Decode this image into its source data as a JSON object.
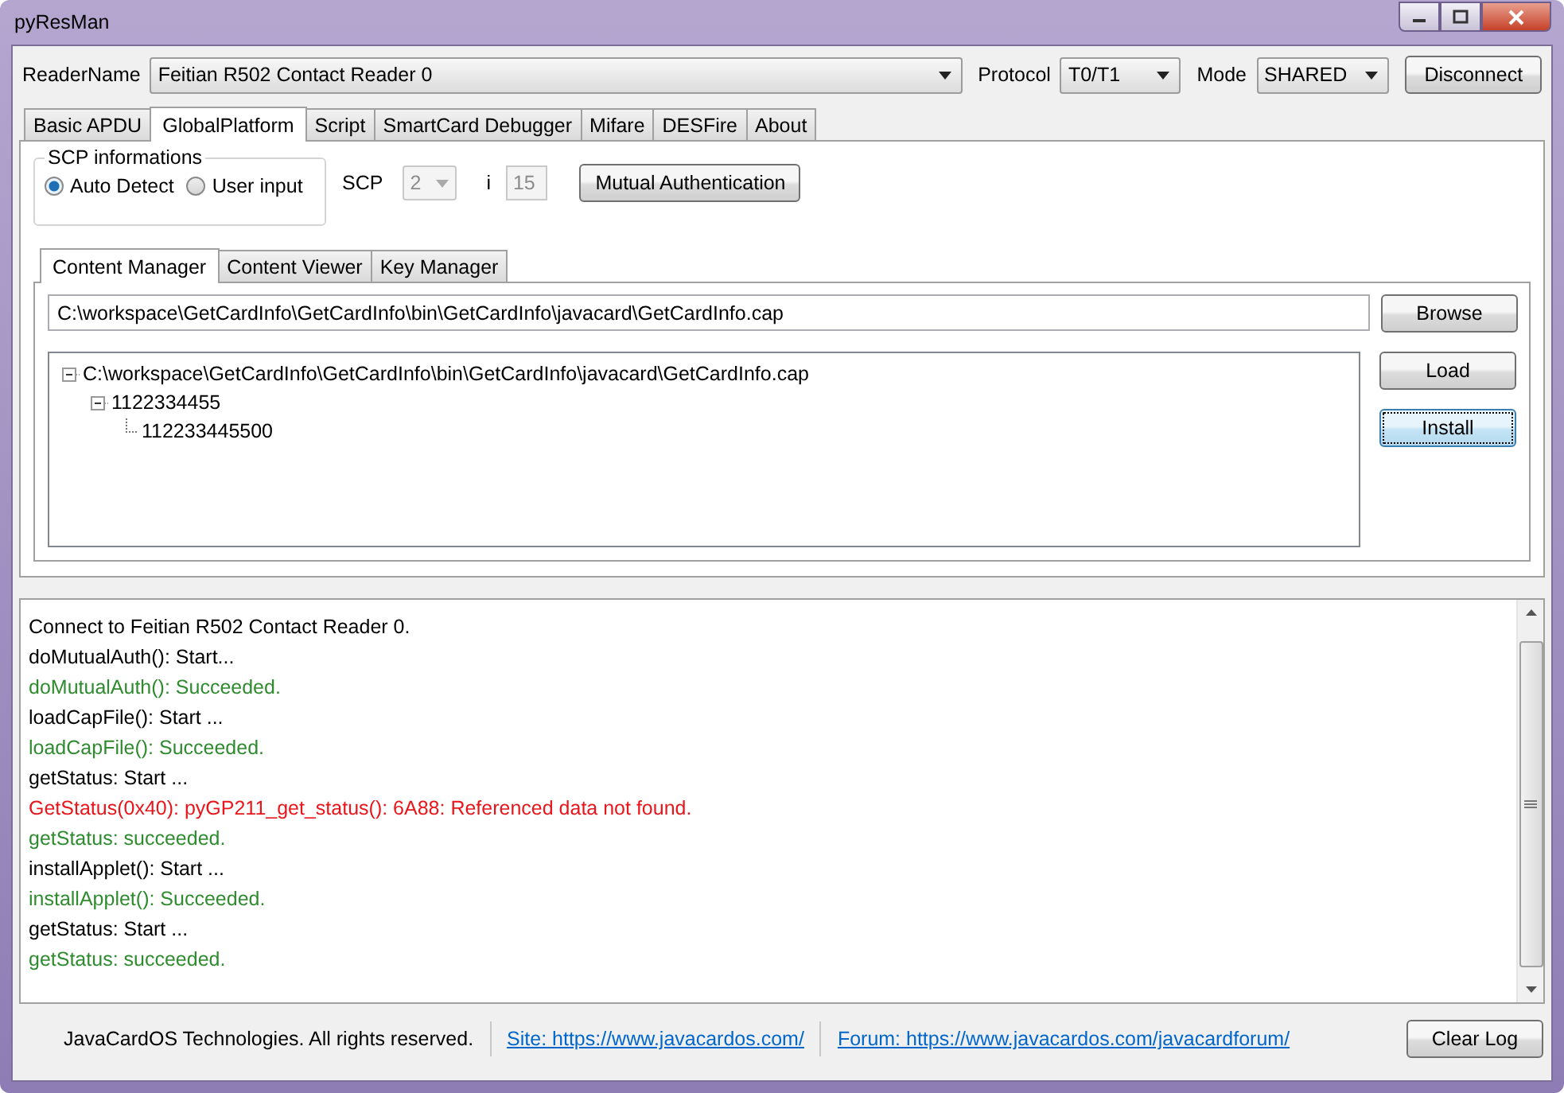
{
  "window": {
    "title": "pyResMan"
  },
  "reader": {
    "label": "ReaderName",
    "value": "Feitian R502 Contact Reader 0"
  },
  "protocol": {
    "label": "Protocol",
    "value": "T0/T1"
  },
  "mode": {
    "label": "Mode",
    "value": "SHARED"
  },
  "connect_button": "Disconnect",
  "tabs": [
    {
      "label": "Basic APDU",
      "selected": false
    },
    {
      "label": "GlobalPlatform",
      "selected": true
    },
    {
      "label": "Script",
      "selected": false
    },
    {
      "label": "SmartCard Debugger",
      "selected": false
    },
    {
      "label": "Mifare",
      "selected": false
    },
    {
      "label": "DESFire",
      "selected": false
    },
    {
      "label": "About",
      "selected": false
    }
  ],
  "scp": {
    "group_title": "SCP informations",
    "options": [
      {
        "label": "Auto Detect",
        "selected": true
      },
      {
        "label": "User input",
        "selected": false
      }
    ],
    "scp_label": "SCP",
    "scp_value": "2",
    "scp_disabled": true,
    "i_label": "i",
    "i_value": "15",
    "i_disabled": true,
    "auth_button": "Mutual Authentication"
  },
  "sub_tabs": [
    {
      "label": "Content Manager",
      "selected": true
    },
    {
      "label": "Content Viewer",
      "selected": false
    },
    {
      "label": "Key Manager",
      "selected": false
    }
  ],
  "cap_path": "C:\\workspace\\GetCardInfo\\GetCardInfo\\bin\\GetCardInfo\\javacard\\GetCardInfo.cap",
  "browse_button": "Browse",
  "tree": [
    {
      "label": "C:\\workspace\\GetCardInfo\\GetCardInfo\\bin\\GetCardInfo\\javacard\\GetCardInfo.cap",
      "expanded": true,
      "children": [
        {
          "label": "1122334455",
          "expanded": true,
          "children": [
            {
              "label": "112233445500"
            }
          ]
        }
      ]
    }
  ],
  "buttons": [
    {
      "label": "Load",
      "focused": false
    },
    {
      "label": "Install",
      "focused": true
    }
  ],
  "log": [
    {
      "text": "Connect to Feitian R502 Contact Reader 0.",
      "color": "#000000"
    },
    {
      "text": "doMutualAuth(): Start...",
      "color": "#000000"
    },
    {
      "text": "doMutualAuth(): Succeeded.",
      "color": "#2e8b2e"
    },
    {
      "text": "loadCapFile(): Start ...",
      "color": "#000000"
    },
    {
      "text": "loadCapFile(): Succeeded.",
      "color": "#2e8b2e"
    },
    {
      "text": "getStatus: Start ...",
      "color": "#000000"
    },
    {
      "text": "GetStatus(0x40): pyGP211_get_status(): 6A88: Referenced data not found.",
      "color": "#e8161b"
    },
    {
      "text": "getStatus: succeeded.",
      "color": "#2e8b2e"
    },
    {
      "text": "installApplet(): Start ...",
      "color": "#000000"
    },
    {
      "text": "installApplet(): Succeeded.",
      "color": "#2e8b2e"
    },
    {
      "text": "getStatus: Start ...",
      "color": "#000000"
    },
    {
      "text": "getStatus: succeeded.",
      "color": "#2e8b2e"
    }
  ],
  "footer": {
    "copyright": "JavaCardOS Technologies. All rights reserved.",
    "links": [
      "Site: https://www.javacardos.com/",
      "Forum: https://www.javacardos.com/javacardforum/"
    ]
  },
  "clear_button": "Clear Log"
}
